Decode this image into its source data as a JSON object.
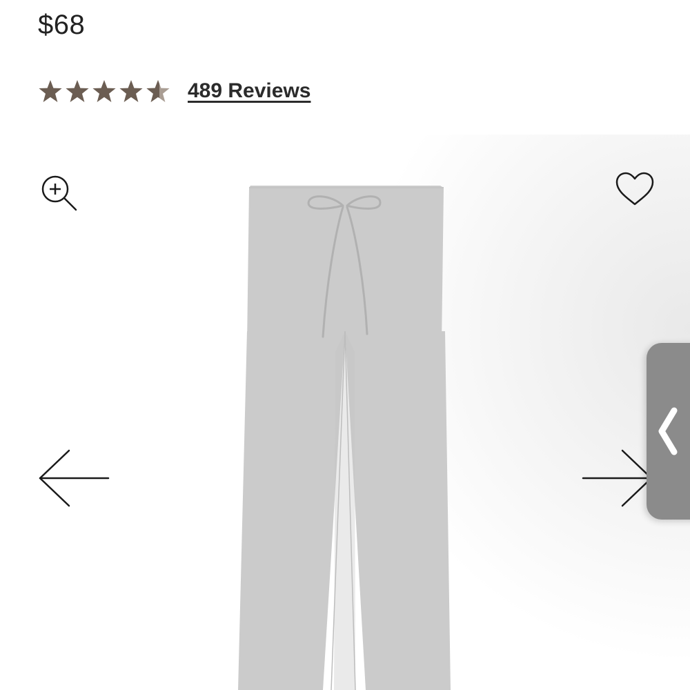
{
  "product": {
    "price": "$68",
    "rating": 4.9,
    "rating_max": 5,
    "reviews_label": "489 Reviews"
  },
  "icons": {
    "zoom": "zoom-in-icon",
    "wishlist": "heart-icon",
    "prev": "arrow-left-icon",
    "next": "arrow-right-icon",
    "side_tab": "chevron-left-icon"
  },
  "colors": {
    "star": "#6b5d52",
    "text": "#222222",
    "product_gray": "#cbcbcb",
    "side_tab": "#8b8b8b"
  }
}
